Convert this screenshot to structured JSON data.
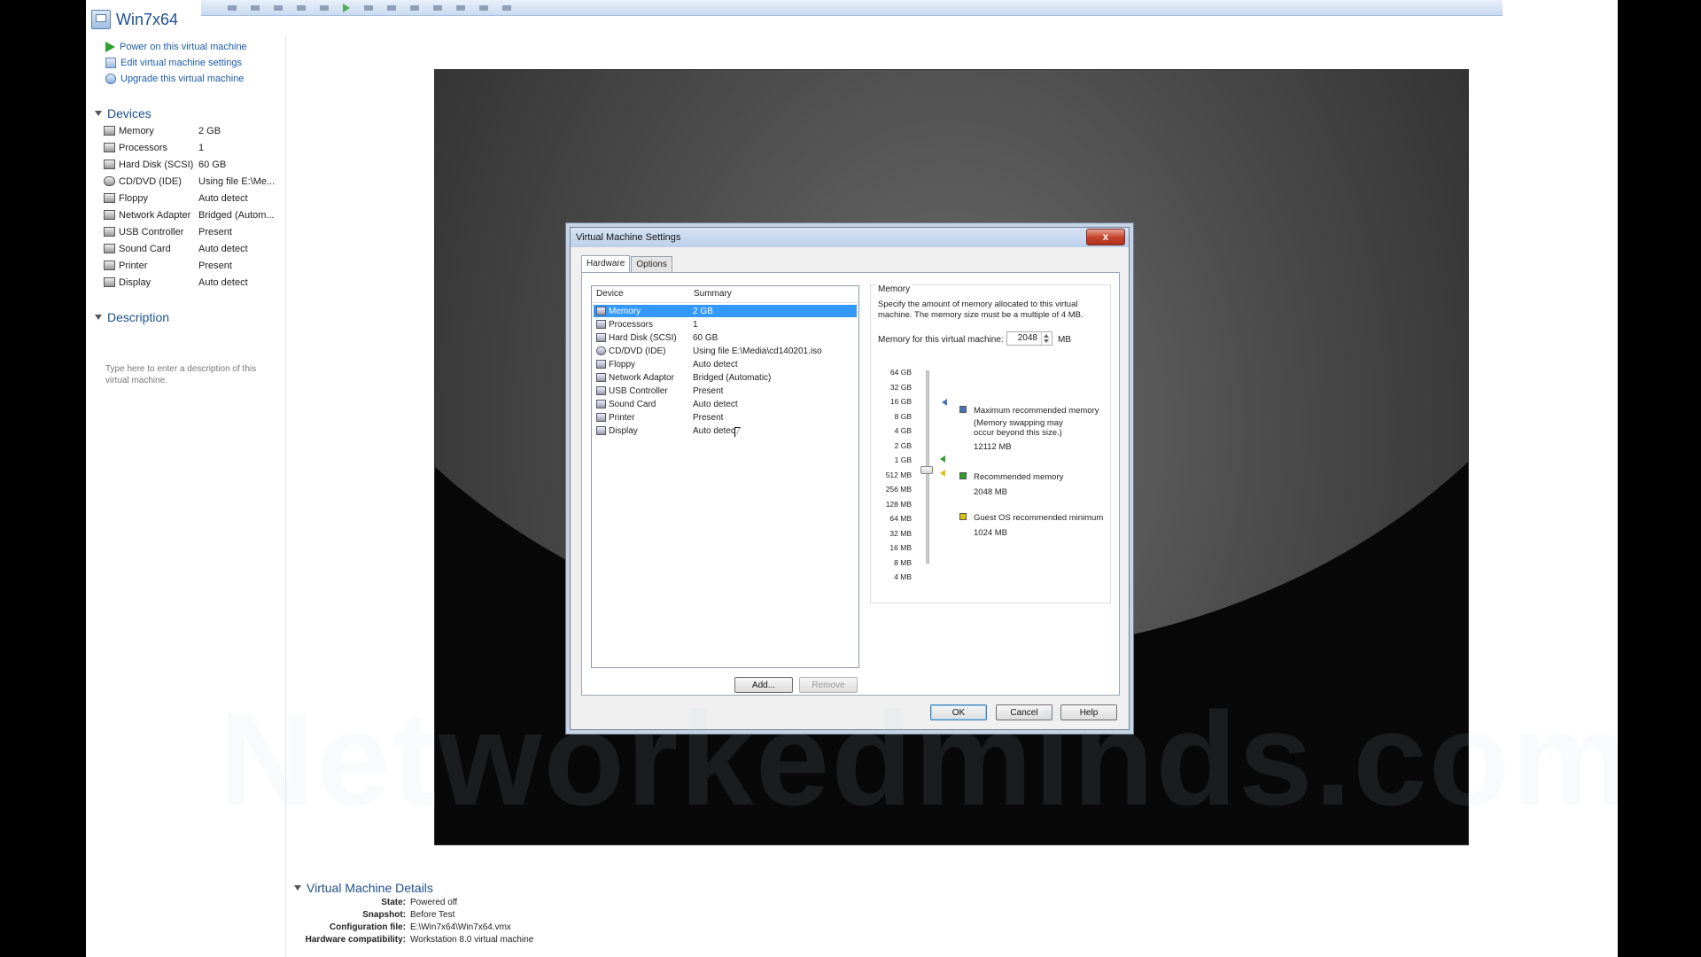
{
  "window": {
    "title": "Win7x64"
  },
  "commands": [
    {
      "label": "Power on this virtual machine",
      "icon": "play-icon"
    },
    {
      "label": "Edit virtual machine settings",
      "icon": "edit-settings-icon"
    },
    {
      "label": "Upgrade this virtual machine",
      "icon": "upgrade-icon"
    }
  ],
  "devices": {
    "heading": "Devices",
    "items": [
      {
        "name": "Memory",
        "summary": "2 GB",
        "icon": "memory-icon"
      },
      {
        "name": "Processors",
        "summary": "1",
        "icon": "processor-icon"
      },
      {
        "name": "Hard Disk (SCSI)",
        "summary": "60 GB",
        "icon": "hard-disk-icon"
      },
      {
        "name": "CD/DVD (IDE)",
        "summary": "Using file E:\\Me...",
        "icon": "cd-dvd-icon"
      },
      {
        "name": "Floppy",
        "summary": "Auto detect",
        "icon": "floppy-icon"
      },
      {
        "name": "Network Adapter",
        "summary": "Bridged (Autom...",
        "icon": "network-icon"
      },
      {
        "name": "USB Controller",
        "summary": "Present",
        "icon": "usb-icon"
      },
      {
        "name": "Sound Card",
        "summary": "Auto detect",
        "icon": "sound-icon"
      },
      {
        "name": "Printer",
        "summary": "Present",
        "icon": "printer-icon"
      },
      {
        "name": "Display",
        "summary": "Auto detect",
        "icon": "display-icon"
      }
    ]
  },
  "description": {
    "heading": "Description",
    "placeholder": "Type here to enter a description of this virtual machine."
  },
  "dialog": {
    "title": "Virtual Machine Settings",
    "close": "x",
    "tabs": [
      "Hardware",
      "Options"
    ],
    "list_headers": {
      "device": "Device",
      "summary": "Summary"
    },
    "list": [
      {
        "name": "Memory",
        "summary": "2 GB",
        "selected": true
      },
      {
        "name": "Processors",
        "summary": "1"
      },
      {
        "name": "Hard Disk (SCSI)",
        "summary": "60 GB"
      },
      {
        "name": "CD/DVD (IDE)",
        "summary": "Using file E:\\Media\\cd140201.iso"
      },
      {
        "name": "Floppy",
        "summary": "Auto detect"
      },
      {
        "name": "Network Adaptor",
        "summary": "Bridged (Automatic)"
      },
      {
        "name": "USB Controller",
        "summary": "Present"
      },
      {
        "name": "Sound Card",
        "summary": "Auto detect"
      },
      {
        "name": "Printer",
        "summary": "Present"
      },
      {
        "name": "Display",
        "summary": "Auto detect"
      }
    ],
    "add_button": "Add...",
    "remove_button": "Remove",
    "memory": {
      "group_title": "Memory",
      "description": "Specify the amount of memory allocated to this virtual machine. The memory size must be a multiple of 4 MB.",
      "field_label": "Memory for this virtual machine:",
      "value": "2048",
      "unit": "MB",
      "scale": [
        "64 GB",
        "32 GB",
        "16 GB",
        "8 GB",
        "4 GB",
        "2 GB",
        "1 GB",
        "512 MB",
        "256 MB",
        "128 MB",
        "64 MB",
        "32 MB",
        "16 MB",
        "8 MB",
        "4 MB"
      ],
      "legend": {
        "max_title": "Maximum recommended memory",
        "max_note": "(Memory swapping may occur beyond this size.)",
        "max_value": "12112 MB",
        "rec_title": "Recommended memory",
        "rec_value": "2048 MB",
        "min_title": "Guest OS recommended minimum",
        "min_value": "1024 MB"
      },
      "colors": {
        "max": "#4a74b8",
        "recommended": "#2f9e2f",
        "minimum": "#d9c214"
      }
    },
    "ok_button": "OK",
    "cancel_button": "Cancel",
    "help_button": "Help"
  },
  "details": {
    "heading": "Virtual Machine Details",
    "rows": [
      {
        "key": "State:",
        "value": "Powered off"
      },
      {
        "key": "Snapshot:",
        "value": "Before Test"
      },
      {
        "key": "Configuration file:",
        "value": "E:\\Win7x64\\Win7x64.vmx"
      },
      {
        "key": "Hardware compatibility:",
        "value": "Workstation 8.0 virtual machine"
      }
    ]
  },
  "watermark": "Networkedminds.com"
}
